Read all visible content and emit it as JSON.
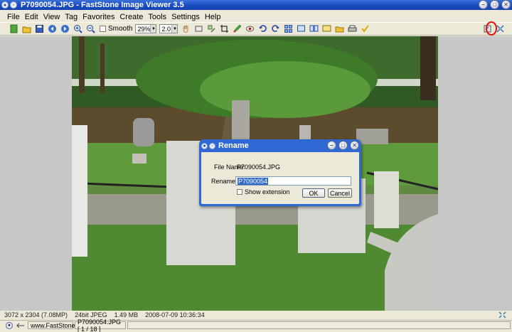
{
  "window": {
    "title_file": "P7090054.JPG",
    "title_sep": " - ",
    "title_app": "FastStone Image Viewer 3.5",
    "minimize_glyph": "–",
    "maximize_glyph": "□",
    "close_glyph": "✕"
  },
  "menu": {
    "items": [
      "File",
      "Edit",
      "View",
      "Tag",
      "Favorites",
      "Create",
      "Tools",
      "Settings",
      "Help"
    ]
  },
  "toolbar": {
    "smooth_label": "Smooth",
    "zoom_value": "29%",
    "zoom_step": "2.0",
    "icons": [
      "open-icon",
      "open-folder-icon",
      "save-icon",
      "prev-icon",
      "next-icon",
      "zoom-in-icon",
      "zoom-out-icon"
    ],
    "highlight_color": "#e01010"
  },
  "dialog": {
    "title": "Rename",
    "file_name_label": "File Name:",
    "file_name_value": "P7090054.JPG",
    "rename_to_label": "Rename to:",
    "rename_to_value": "P7090054",
    "show_extension_label": "Show extension",
    "ok_label": "OK",
    "cancel_label": "Cancel"
  },
  "status": {
    "dimensions": "3072 x 2304 (7.08MP)",
    "format": "24bit JPEG",
    "size": "1.49 MB",
    "datetime": "2008-07-09 10:36:34",
    "website": "www.FastStone.org",
    "file_position": "P7090054.JPG [ 1 / 18 ]"
  },
  "colors": {
    "titlebar": "#1c4fc2",
    "dialog_frame": "#2f67d4",
    "selection": "#316ac5"
  }
}
